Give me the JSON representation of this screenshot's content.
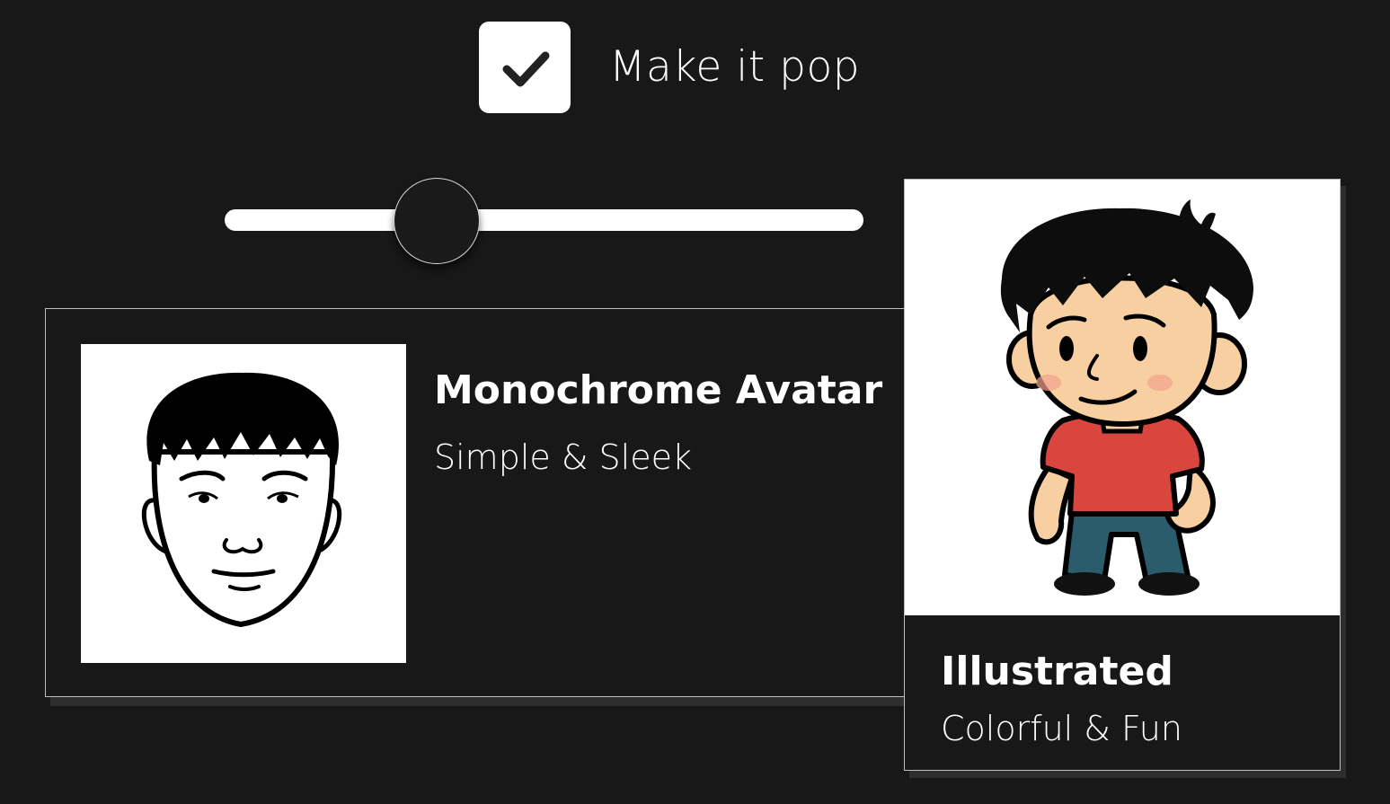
{
  "toggle": {
    "label": "Make it pop",
    "checked": true
  },
  "slider": {
    "value_fraction": 0.33
  },
  "cards": [
    {
      "title": "Monochrome Avatar",
      "subtitle": "Simple & Sleek",
      "image": "monochrome-face-avatar"
    },
    {
      "title": "Illustrated",
      "subtitle": "Colorful & Fun",
      "image": "illustrated-boy-avatar"
    }
  ],
  "colors": {
    "background": "#181818",
    "foreground": "#ffffff",
    "card_border": "#bfbfbf",
    "shirt": "#d9463e",
    "pants": "#2b5c6b",
    "skin": "#f7cfa0",
    "blush": "#f3a28f"
  }
}
